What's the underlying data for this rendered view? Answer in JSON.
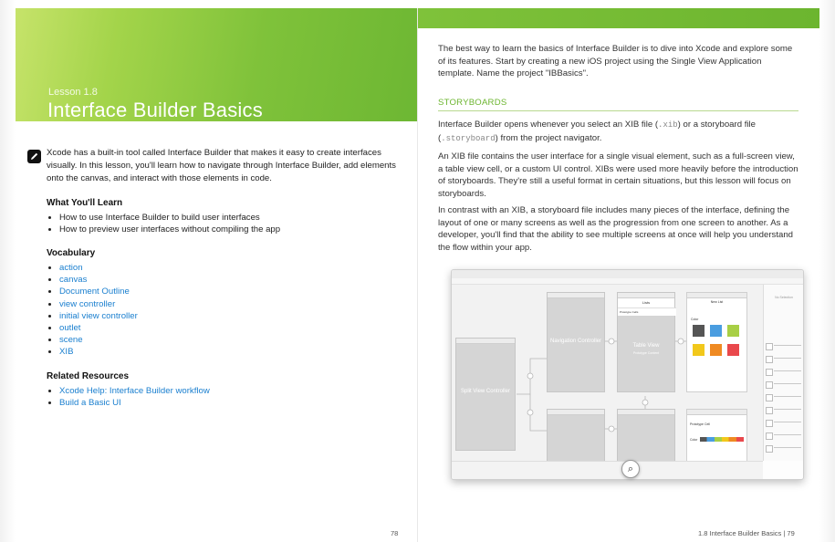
{
  "left_page": {
    "lesson_number": "Lesson 1.8",
    "lesson_title": "Interface Builder Basics",
    "intro_icon": "pencil-icon",
    "intro": "Xcode has a built-in tool called Interface Builder that makes it easy to create interfaces visually. In this lesson, you'll learn how to navigate through Interface Builder, add elements onto the canvas, and interact with those elements in code.",
    "learn_heading": "What You'll Learn",
    "learn_items": [
      "How to use Interface Builder to build user interfaces",
      "How to preview user interfaces without compiling the app"
    ],
    "vocab_heading": "Vocabulary",
    "vocab_items": [
      "action",
      "canvas",
      "Document Outline",
      "view controller",
      "initial view controller",
      "outlet",
      "scene",
      "XIB"
    ],
    "resources_heading": "Related Resources",
    "resources_items": [
      "Xcode Help: Interface Builder workflow",
      "Build a Basic UI"
    ],
    "page_number": "78"
  },
  "right_page": {
    "para1": "The best way to learn the basics of Interface Builder is to dive into Xcode and explore some of its features. Start by creating a new iOS project using the Single View Application template. Name the project \"IBBasics\".",
    "section_heading": "STORYBOARDS",
    "para2_a": "Interface Builder opens whenever you select an XIB file (",
    "para2_code1": ".xib",
    "para2_b": ") or a storyboard file (",
    "para2_code2": ".storyboard",
    "para2_c": ") from the project navigator.",
    "para3": "An XIB file contains the user interface for a single visual element, such as a full-screen view, a table view cell, or a custom UI control. XIBs were used more heavily before the introduction of storyboards. They're still a useful format in certain situations, but this lesson will focus on storyboards.",
    "para4": "In contrast with an XIB, a storyboard file includes many pieces of the interface, defining the layout of one or many screens as well as the progression from one screen to another. As a developer, you'll find that the ability to see multiple screens at once will help you understand the flow within your app.",
    "screenshot": {
      "split_view_label": "Split View Controller",
      "nav_label": "Navigation Controller",
      "table_label": "Table View",
      "table_sub": "Prototype Content",
      "list_title": "Lists",
      "list_item": "Prototype Cells",
      "detail_title": "New List",
      "detail_item": "Color",
      "prototype_label": "Prototype Cell",
      "color_label": "Color",
      "inspector_label": "No Selection",
      "swatch_colors": [
        "#555555",
        "#4a9de0",
        "#a8cf45",
        "#f2c81b",
        "#ef8a22",
        "#e9484c"
      ],
      "zoom_icon": "magnifier-icon"
    },
    "page_footer": "1.8 Interface Builder Basics | 79"
  }
}
